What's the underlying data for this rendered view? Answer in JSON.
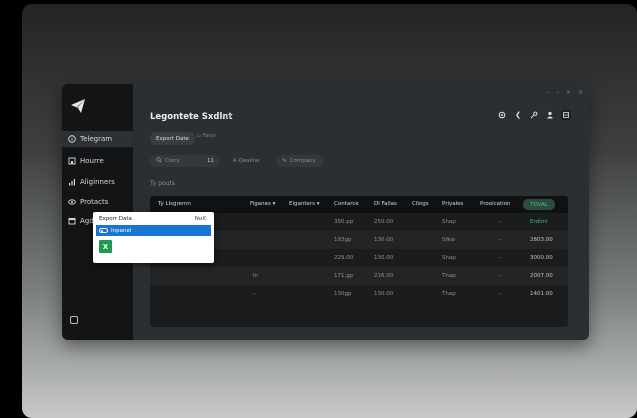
{
  "sidebar": {
    "items": [
      {
        "label": "Telegram",
        "icon": "info-circle-icon",
        "active": true
      },
      {
        "label": "Hourre",
        "icon": "home-icon"
      },
      {
        "label": "Aliginners",
        "icon": "chart-icon"
      },
      {
        "label": "Protacts",
        "icon": "eye-icon"
      },
      {
        "label": "Agdina",
        "icon": "calendar-icon"
      }
    ]
  },
  "header": {
    "title": "Legontete Sxdlnt",
    "subtitle": "• fo",
    "window_controls": [
      "–",
      "–",
      "×",
      "×"
    ]
  },
  "toolbar": {
    "export_label": "Export Date",
    "fatal_label": "Fatal"
  },
  "filters": {
    "query": "Ctery",
    "query_badge": "11",
    "qualifier": "A Qealine",
    "company": "Company"
  },
  "section_label": "Ty pouts",
  "table": {
    "columns": [
      "Ty Llsgremn",
      "Figanes ▾",
      "Elganters ▾",
      "Contarce",
      "Dl Fallas",
      "Cllogs",
      "Priyales",
      "Proolcation",
      "TOVAL"
    ],
    "rows": [
      [
        "",
        "",
        "",
        "350.pp",
        "250.00",
        "",
        "Shap",
        "–",
        "Erdlml"
      ],
      [
        "",
        "",
        "",
        "193gp",
        "130.00",
        "",
        "Sfkw",
        "–",
        "2803.00"
      ],
      [
        "",
        "",
        "",
        "229.00",
        "130.00",
        "",
        "Shap",
        "–",
        "3000.00"
      ],
      [
        "",
        "In",
        "",
        "171.gp",
        "216.00",
        "",
        "Thap",
        "–",
        "2007.00"
      ],
      [
        "",
        "–",
        "",
        "130gp",
        "130.00",
        "",
        "Thap",
        "–",
        "1401.00"
      ]
    ]
  },
  "popup": {
    "title": "Exporr Data",
    "close_label": "NoX",
    "option_label": "Inpanel",
    "excel_label": "X"
  },
  "colors": {
    "accent_green": "#30c07e",
    "selection_blue": "#1876d2",
    "excel_green": "#1e9b4e"
  }
}
